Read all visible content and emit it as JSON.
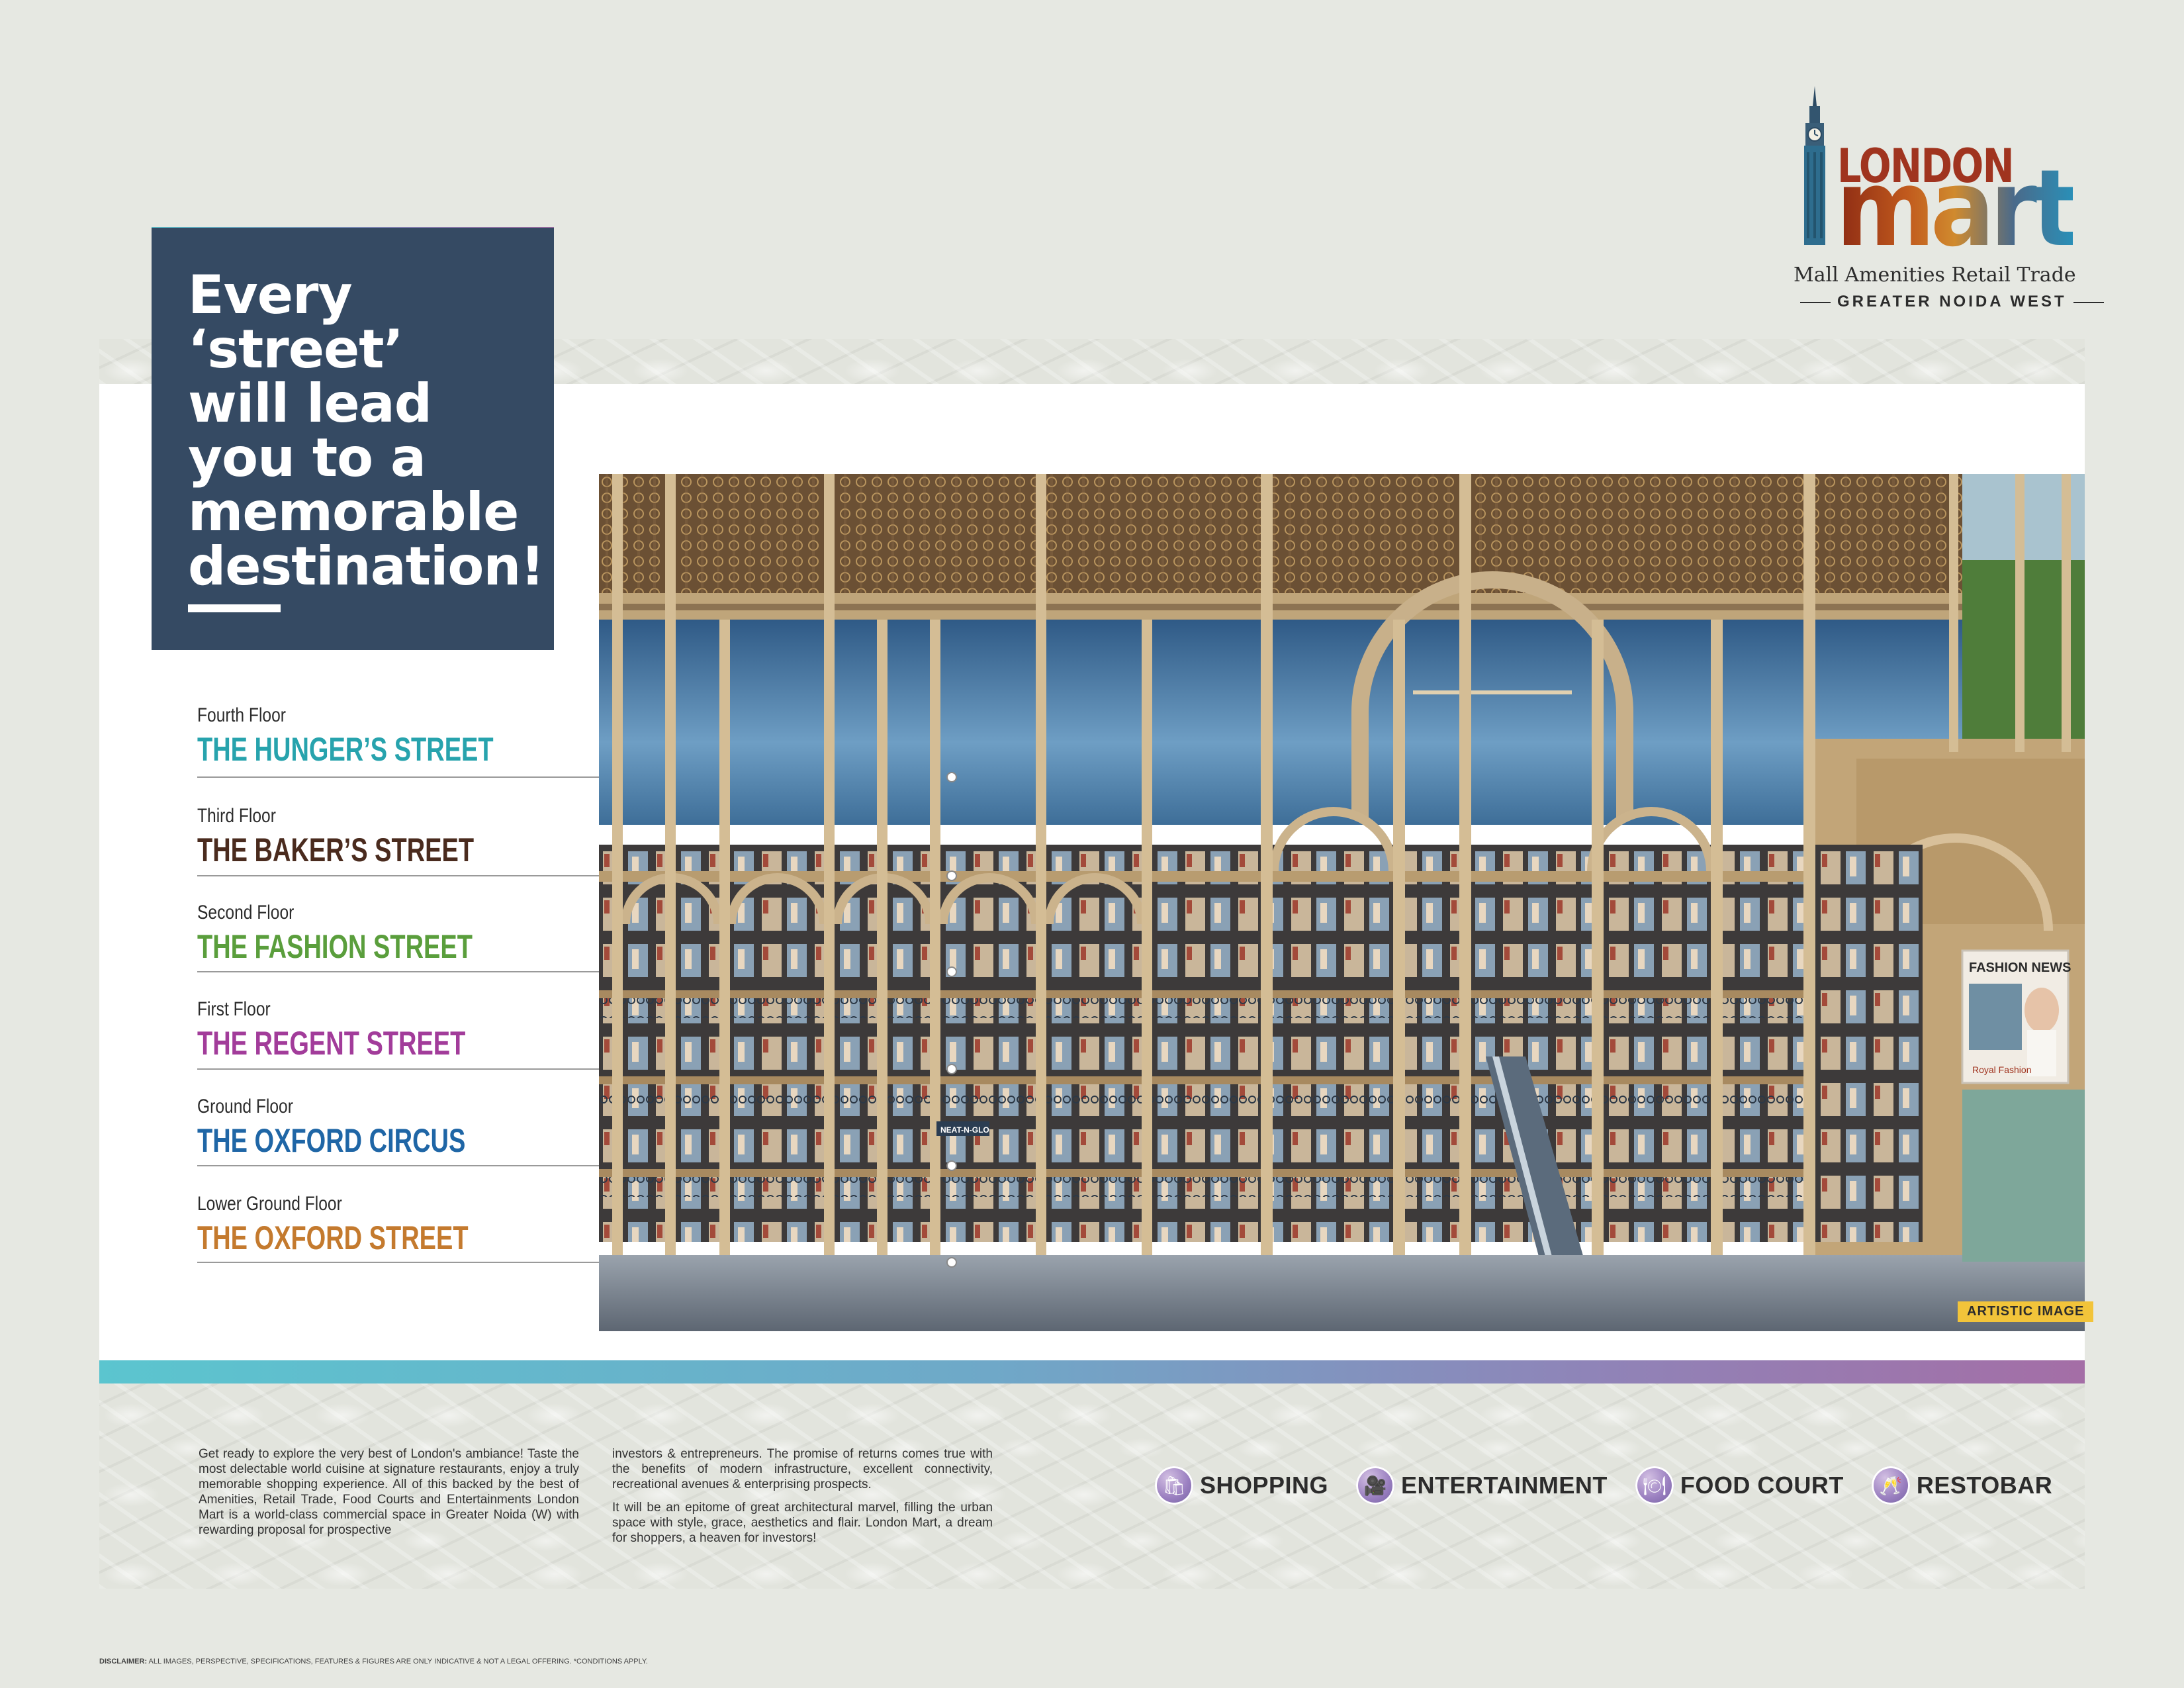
{
  "logo": {
    "brand_top": "LONDON",
    "brand_main": "mart",
    "tagline": "Mall Amenities Retail Trade",
    "location": "GREATER NOIDA WEST"
  },
  "headline": {
    "text": "Every\n‘street’\nwill lead\nyou to a\nmemorable\ndestination!"
  },
  "floors": [
    {
      "name": "Fourth Floor",
      "street": "THE HUNGER’S STREET",
      "color": "#27a3ad"
    },
    {
      "name": "Third Floor",
      "street": "THE BAKER’S STREET",
      "color": "#4a2b1e"
    },
    {
      "name": "Second Floor",
      "street": "THE FASHION STREET",
      "color": "#5a9e3c"
    },
    {
      "name": "First Floor",
      "street": "THE REGENT STREET",
      "color": "#a23c9a"
    },
    {
      "name": "Ground Floor",
      "street": "THE OXFORD CIRCUS",
      "color": "#1f66a6"
    },
    {
      "name": "Lower Ground Floor",
      "street": "THE OXFORD STREET",
      "color": "#c47a2e"
    }
  ],
  "image": {
    "badge": "ARTISTIC IMAGE",
    "sign_fashion": "FASHION NEWS",
    "sign_royal": "Royal Fashion",
    "sign_store": "NEAT-N-GLO"
  },
  "body": {
    "col1": "Get ready to explore the very best of London's ambiance! Taste the most delectable world cuisine at signature restaurants, enjoy a truly memorable shopping experience. All of this backed by the best of Amenities, Retail Trade, Food Courts and Entertainments London Mart is a world-class commercial space in Greater Noida (W) with rewarding proposal for prospective",
    "col2_p1": "investors & entrepreneurs. The promise of returns comes true with the benefits of modern infrastructure, excellent connectivity, recreational avenues & enterprising prospects.",
    "col2_p2": "It will be an epitome of great architectural marvel, filling the urban space with style, grace, aesthetics and flair. London Mart, a dream for shoppers, a heaven for investors!"
  },
  "amenities": [
    {
      "label": "SHOPPING",
      "icon": "shopping-bag-icon",
      "glyph": "🛍"
    },
    {
      "label": "ENTERTAINMENT",
      "icon": "film-camera-icon",
      "glyph": "🎥"
    },
    {
      "label": "FOOD COURT",
      "icon": "cloche-icon",
      "glyph": "🍽"
    },
    {
      "label": "RESTOBAR",
      "icon": "cheers-glasses-icon",
      "glyph": "🥂"
    }
  ],
  "disclaimer": {
    "label": "DISCLAIMER:",
    "text": " ALL IMAGES, PERSPECTIVE, SPECIFICATIONS, FEATURES & FIGURES ARE ONLY INDICATIVE & NOT A LEGAL OFFERING. *CONDITIONS APPLY."
  },
  "colors": {
    "headline_bg": "#354a63",
    "gradient_start": "#5bc5cf",
    "gradient_end": "#a46ea6",
    "badge": "#f2c43a"
  }
}
